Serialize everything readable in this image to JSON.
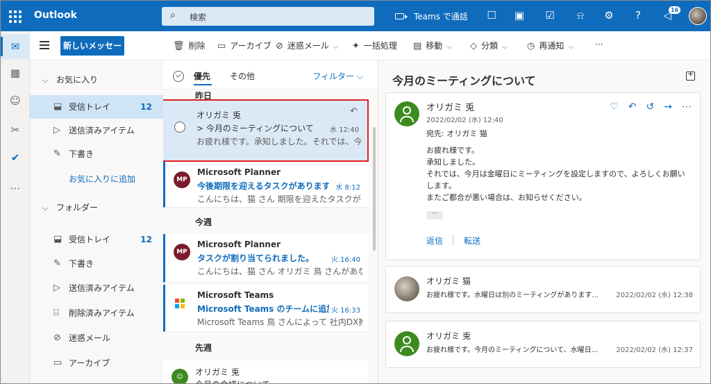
{
  "topbar": {
    "app_name": "Outlook",
    "search_placeholder": "検索",
    "teams_call": "Teams で通話",
    "notification_count": "16",
    "icons": [
      "waffle-icon",
      "search-icon",
      "video-icon",
      "chat-icon",
      "office-icon",
      "todo-icon",
      "bell-icon",
      "gear-icon",
      "help-icon",
      "megaphone-icon",
      "avatar"
    ]
  },
  "rail": [
    "mail-icon",
    "calendar-icon",
    "people-icon",
    "attach-icon",
    "check-icon",
    "more-icon"
  ],
  "commands": {
    "new_message": "新しいメッセージ",
    "delete": "削除",
    "archive": "アーカイブ",
    "junk": "迷惑メール",
    "sweep": "一括処理",
    "move": "移動",
    "categorize": "分類",
    "snooze": "再通知",
    "more": "···"
  },
  "folders": {
    "favorites_label": "お気に入り",
    "favorites": [
      {
        "label": "受信トレイ",
        "count": "12"
      },
      {
        "label": "送信済みアイテム",
        "count": ""
      },
      {
        "label": "下書き",
        "count": ""
      }
    ],
    "add_favorite": "お気に入りに追加",
    "folders_label": "フォルダー",
    "items": [
      {
        "label": "受信トレイ",
        "count": "12"
      },
      {
        "label": "下書き",
        "count": ""
      },
      {
        "label": "送信済みアイテム",
        "count": ""
      },
      {
        "label": "削除済みアイテム",
        "count": ""
      },
      {
        "label": "迷惑メール",
        "count": ""
      },
      {
        "label": "アーカイブ",
        "count": ""
      }
    ]
  },
  "list": {
    "tab_focused": "優先",
    "tab_other": "その他",
    "filter": "フィルター",
    "groups": {
      "yesterday": "昨日",
      "this_week": "今週",
      "last_week": "先週"
    },
    "messages": [
      {
        "sender": "オリガミ 兎",
        "subject": "> 今月のミーティングについて",
        "time": "水 12:40",
        "preview": "お疲れ様です。承知しました。それでは、今月..."
      },
      {
        "avatar": "MP",
        "sender": "Microsoft Planner",
        "subject": "今後期限を迎えるタスクがあります。",
        "time": "水 8:12",
        "preview": "こんにちは、猫 さん 期限を迎えたタスクが Mic..."
      },
      {
        "avatar": "MP",
        "sender": "Microsoft Planner",
        "subject": "タスクが割り当てられました。",
        "time": "火 16:40",
        "preview": "こんにちは、猫 さん オリガミ 鳥 さんがあなたに..."
      },
      {
        "sender": "Microsoft Teams",
        "subject": "Microsoft Teams のチームに追加...",
        "time": "火 16:33",
        "preview": "Microsoft Teams 鳥 さんによって 社内DX推..."
      },
      {
        "sender": "オリガミ 兎",
        "subject": "今月の会議について",
        "time": "",
        "preview": ""
      }
    ]
  },
  "reading": {
    "title": "今月のミーティングについて",
    "main": {
      "sender": "オリガミ 兎",
      "date": "2022/02/02 (水) 12:40",
      "to": "宛先: オリガミ 猫",
      "body": [
        "お疲れ様です。",
        "承知しました。",
        "それでは、今月は金曜日にミーティングを設定しますので、よろしくお願い",
        "します。",
        "またご都合が悪い場合は、お知らせください。"
      ],
      "more": "···",
      "reply": "返信",
      "forward": "転送"
    },
    "thread": [
      {
        "sender": "オリガミ 猫",
        "preview": "お疲れ様です。水曜日は別のミーティングがあります...",
        "time": "2022/02/02 (水) 12:38"
      },
      {
        "sender": "オリガミ 兎",
        "preview": "お疲れ様です。今月のミーティングについて、水曜日...",
        "time": "2022/02/02 (水) 12:37"
      }
    ]
  },
  "colors": {
    "brand": "#0f6cbd",
    "selection_outline": "#e02020",
    "avatar_green": "#3d8b1f",
    "planner": "#7a1a2c"
  }
}
